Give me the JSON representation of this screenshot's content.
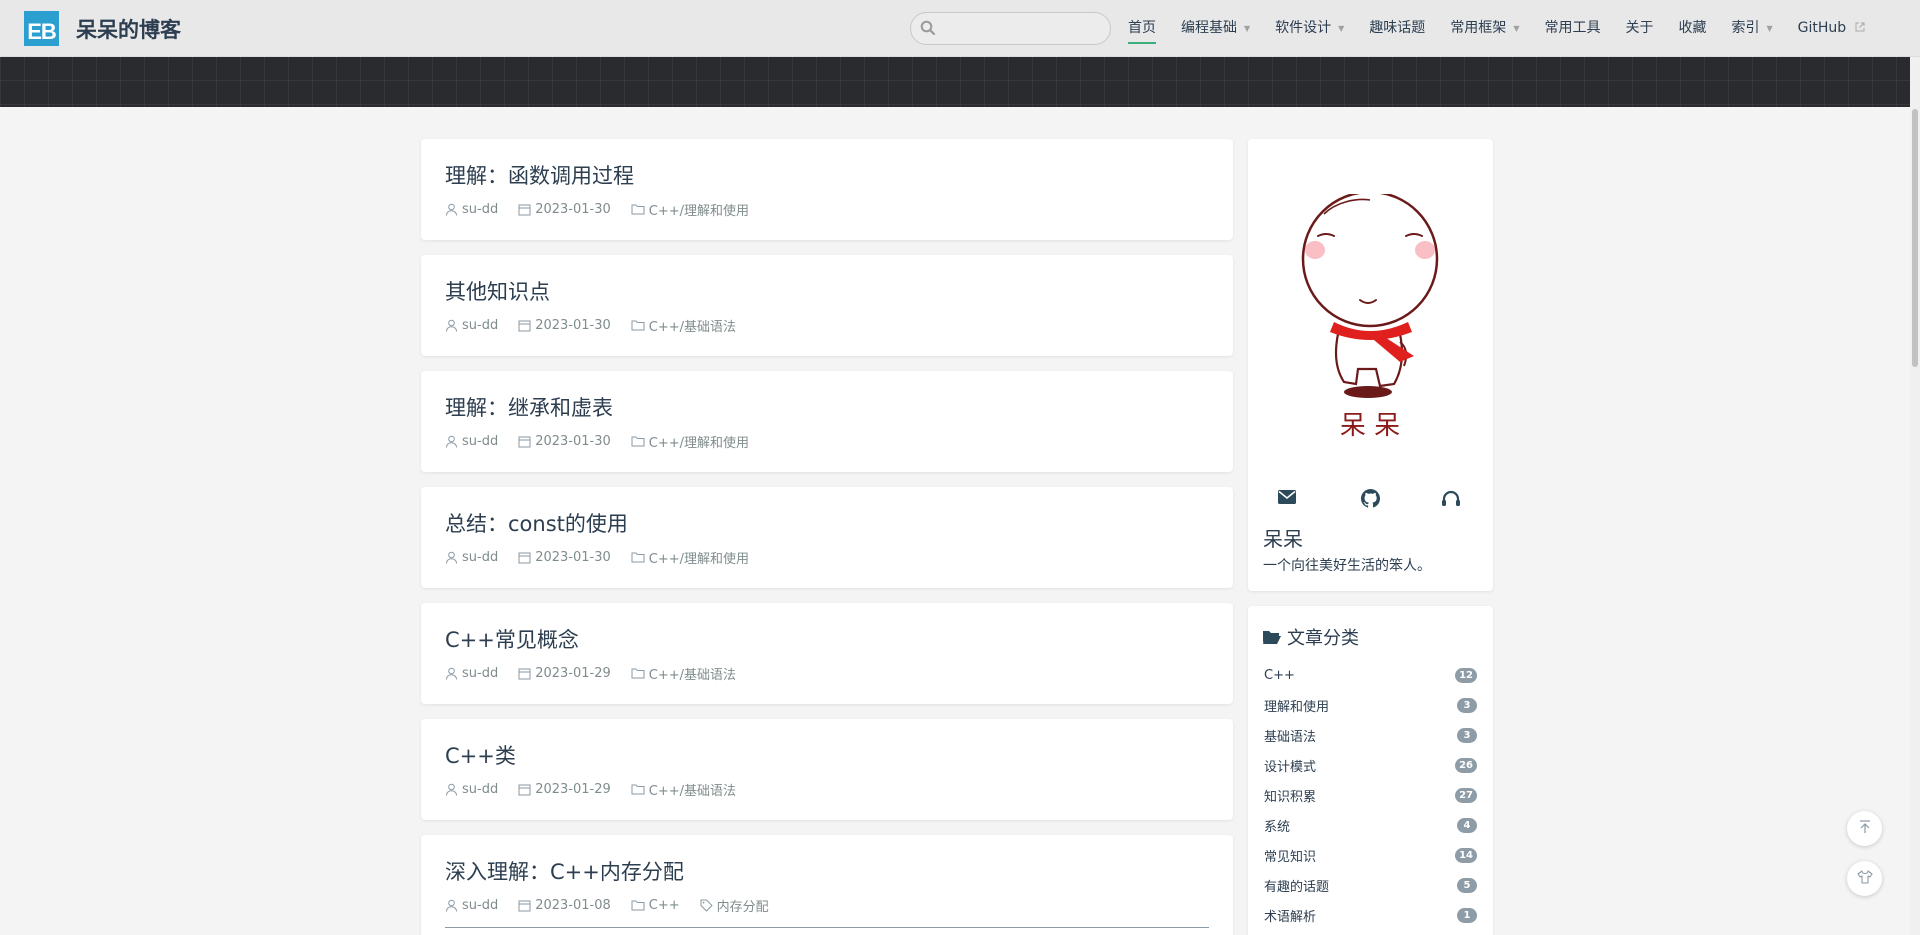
{
  "header": {
    "logo_text": "EB",
    "site_title": "呆呆的博客",
    "search_placeholder": "",
    "nav": [
      {
        "label": "首页",
        "caret": false,
        "active": true
      },
      {
        "label": "编程基础",
        "caret": true
      },
      {
        "label": "软件设计",
        "caret": true
      },
      {
        "label": "趣味话题",
        "caret": false
      },
      {
        "label": "常用框架",
        "caret": true
      },
      {
        "label": "常用工具",
        "caret": false
      },
      {
        "label": "关于",
        "caret": false
      },
      {
        "label": "收藏",
        "caret": false
      },
      {
        "label": "索引",
        "caret": true
      },
      {
        "label": "GitHub",
        "caret": false,
        "external": true
      }
    ]
  },
  "posts": [
    {
      "title": "理解：函数调用过程",
      "author": "su-dd",
      "date": "2023-01-30",
      "category": "C++/理解和使用"
    },
    {
      "title": "其他知识点",
      "author": "su-dd",
      "date": "2023-01-30",
      "category": "C++/基础语法"
    },
    {
      "title": "理解：继承和虚表",
      "author": "su-dd",
      "date": "2023-01-30",
      "category": "C++/理解和使用"
    },
    {
      "title": "总结：const的使用",
      "author": "su-dd",
      "date": "2023-01-30",
      "category": "C++/理解和使用"
    },
    {
      "title": "C++常见概念",
      "author": "su-dd",
      "date": "2023-01-29",
      "category": "C++/基础语法"
    },
    {
      "title": "C++类",
      "author": "su-dd",
      "date": "2023-01-29",
      "category": "C++/基础语法"
    },
    {
      "title": "深入理解：C++内存分配",
      "author": "su-dd",
      "date": "2023-01-08",
      "category": "C++",
      "tag": "内存分配"
    }
  ],
  "profile": {
    "avatar_caption": "呆 呆",
    "name": "呆呆",
    "description": "一个向往美好生活的笨人。"
  },
  "categories": {
    "heading": "文章分类",
    "items": [
      {
        "label": "C++",
        "count": "12"
      },
      {
        "label": "理解和使用",
        "count": "3"
      },
      {
        "label": "基础语法",
        "count": "3"
      },
      {
        "label": "设计模式",
        "count": "26"
      },
      {
        "label": "知识积累",
        "count": "27"
      },
      {
        "label": "系统",
        "count": "4"
      },
      {
        "label": "常见知识",
        "count": "14"
      },
      {
        "label": "有趣的话题",
        "count": "5"
      },
      {
        "label": "术语解析",
        "count": "1"
      }
    ]
  },
  "colors": {
    "accent": "#3eaf7c",
    "logo_bg": "#2a9fd0",
    "banner": "#2a2b2e",
    "avatar_ink": "#6b1a1a",
    "scarf": "#e0201e"
  }
}
